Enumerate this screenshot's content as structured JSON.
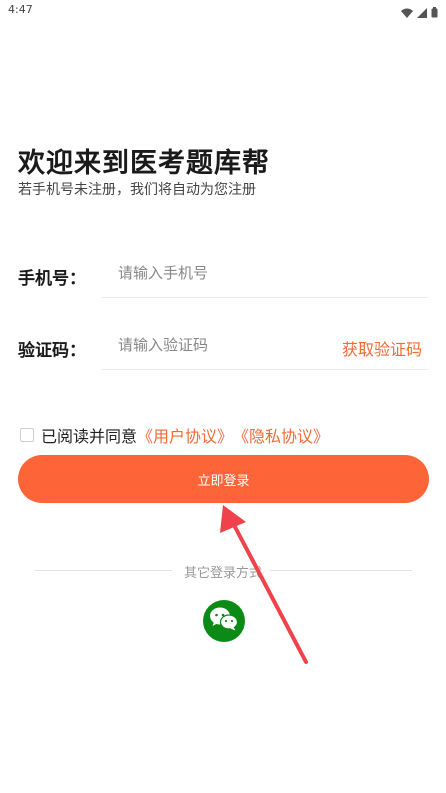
{
  "status_bar": {
    "time": "4:47",
    "icons": [
      "wifi-icon",
      "signal-icon",
      "battery-icon"
    ]
  },
  "header": {
    "title": "欢迎来到医考题库帮",
    "subtitle": "若手机号未注册，我们将自动为您注册"
  },
  "form": {
    "phone_label": "手机号：",
    "phone_placeholder": "请输入手机号",
    "code_label": "验证码：",
    "code_placeholder": "请输入验证码",
    "get_code": "获取验证码"
  },
  "agreement": {
    "prefix": "已阅读并同意",
    "user_agreement": "《用户协议》",
    "privacy_agreement": "《隐私协议》",
    "checked": false
  },
  "login_button": "立即登录",
  "other_login": {
    "label": "其它登录方式",
    "icon": "wechat-icon"
  },
  "colors": {
    "accent": "#fd6437",
    "link": "#f06a36",
    "wechat": "#0b8a15",
    "annotation_arrow": "#f0424a"
  }
}
